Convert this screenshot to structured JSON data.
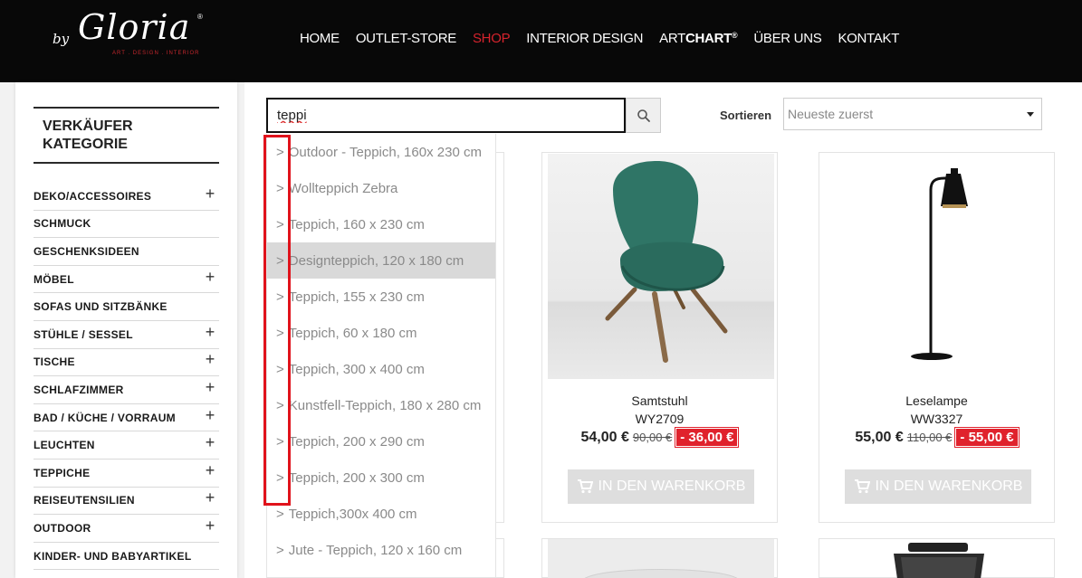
{
  "header": {
    "logo": {
      "by": "by",
      "name": "Gloria",
      "reg": "®",
      "tagline": "ART . DESIGN . INTERIOR"
    },
    "nav": [
      {
        "label": "HOME",
        "active": false
      },
      {
        "label": "OUTLET-STORE",
        "active": false
      },
      {
        "label": "SHOP",
        "active": true
      },
      {
        "label": "INTERIOR DESIGN",
        "active": false
      },
      {
        "label_a": "ART",
        "label_b": "CHART",
        "sup": "®",
        "active": false
      },
      {
        "label": "ÜBER UNS",
        "active": false
      },
      {
        "label": "KONTAKT",
        "active": false
      }
    ]
  },
  "sidebar": {
    "title": "VERKÄUFER KATEGORIE",
    "items": [
      {
        "label": "DEKO/ACCESSOIRES",
        "expand": "+"
      },
      {
        "label": "SCHMUCK",
        "expand": ""
      },
      {
        "label": "GESCHENKSIDEEN",
        "expand": ""
      },
      {
        "label": "MÖBEL",
        "expand": "+"
      },
      {
        "label": "SOFAS UND SITZBÄNKE",
        "expand": ""
      },
      {
        "label": "STÜHLE / SESSEL",
        "expand": "+"
      },
      {
        "label": "TISCHE",
        "expand": "+"
      },
      {
        "label": "SCHLAFZIMMER",
        "expand": "+"
      },
      {
        "label": "BAD / KÜCHE / VORRAUM",
        "expand": "+"
      },
      {
        "label": "LEUCHTEN",
        "expand": "+"
      },
      {
        "label": "TEPPICHE",
        "expand": "+"
      },
      {
        "label": "REISEUTENSILIEN",
        "expand": "+"
      },
      {
        "label": "OUTDOOR",
        "expand": "+"
      },
      {
        "label": "KINDER- UND BABYARTIKEL",
        "expand": ""
      }
    ]
  },
  "search": {
    "value": "teppi"
  },
  "sort": {
    "label": "Sortieren",
    "selected": "Neueste zuerst"
  },
  "suggestions": {
    "prefix": ">",
    "items": [
      "Outdoor - Teppich, 160x 230 cm",
      "Wollteppich Zebra",
      "Teppich, 160 x 230 cm",
      "Designteppich, 120 x 180 cm",
      "Teppich, 155 x 230 cm",
      "Teppich, 60 x 180 cm",
      "Teppich, 300 x 400 cm",
      "Kunstfell-Teppich, 180 x 280 cm",
      "Teppich, 200 x 290 cm",
      "Teppich, 200 x 300 cm",
      "Teppich,300x 400 cm",
      "Jute - Teppich, 120 x 160 cm"
    ],
    "highlighted_index": 3
  },
  "products": [
    {
      "name": "Samtstuhl",
      "sku": "WY2709",
      "price": "54,00 €",
      "old_price": "90,00 €",
      "discount": "- 36,00 €",
      "cart_label": "IN DEN WARENKORB",
      "image": "chair-image"
    },
    {
      "name": "Leselampe",
      "sku": "WW3327",
      "price": "55,00 €",
      "old_price": "110,00 €",
      "discount": "- 55,00 €",
      "cart_label": "IN DEN WARENKORB",
      "image": "floor-lamp-image"
    }
  ],
  "colors": {
    "accent": "#d6232d",
    "header_bg": "#080808",
    "discount_bg": "#e0222c",
    "highlight_box": "#e0121b"
  }
}
